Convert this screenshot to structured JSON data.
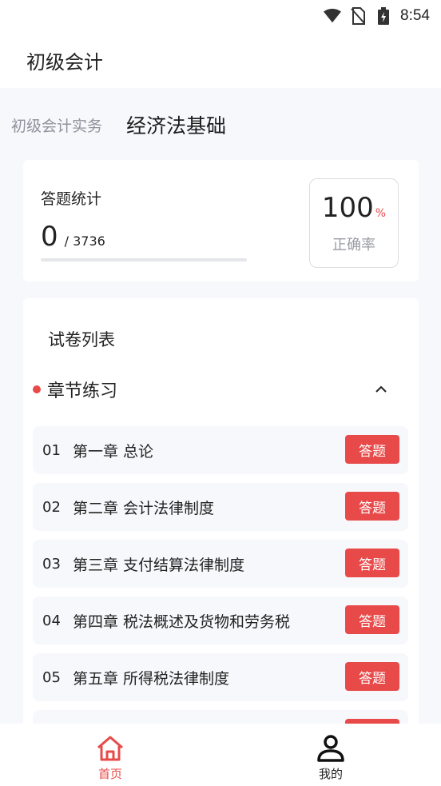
{
  "status_bar": {
    "time": "8:54",
    "icons": [
      "wifi-icon",
      "no-sim-icon",
      "battery-charging-icon"
    ]
  },
  "app_bar": {
    "title": "初级会计"
  },
  "tabs": [
    {
      "label": "初级会计实务",
      "active": false
    },
    {
      "label": "经济法基础",
      "active": true
    }
  ],
  "stats": {
    "label": "答题统计",
    "answered": "0",
    "total": "/ 3736",
    "progress_fraction": 0,
    "accuracy_value": "100",
    "accuracy_unit": "%",
    "accuracy_label": "正确率"
  },
  "paper_list": {
    "title": "试卷列表",
    "section_title": "章节练习",
    "collapse_icon": "chevron-up-icon",
    "answer_label": "答题",
    "chapters": [
      {
        "num": "01",
        "title": "第一章 总论"
      },
      {
        "num": "02",
        "title": "第二章 会计法律制度"
      },
      {
        "num": "03",
        "title": "第三章 支付结算法律制度"
      },
      {
        "num": "04",
        "title": "第四章 税法概述及货物和劳务税"
      },
      {
        "num": "05",
        "title": "第五章 所得税法律制度"
      },
      {
        "num": "",
        "title": ""
      }
    ]
  },
  "bottom_nav": {
    "home_label": "首页",
    "mine_label": "我的"
  },
  "colors": {
    "accent": "#e84a4a",
    "background": "#f7f8fc",
    "card": "#ffffff",
    "muted_text": "#8f939c"
  }
}
